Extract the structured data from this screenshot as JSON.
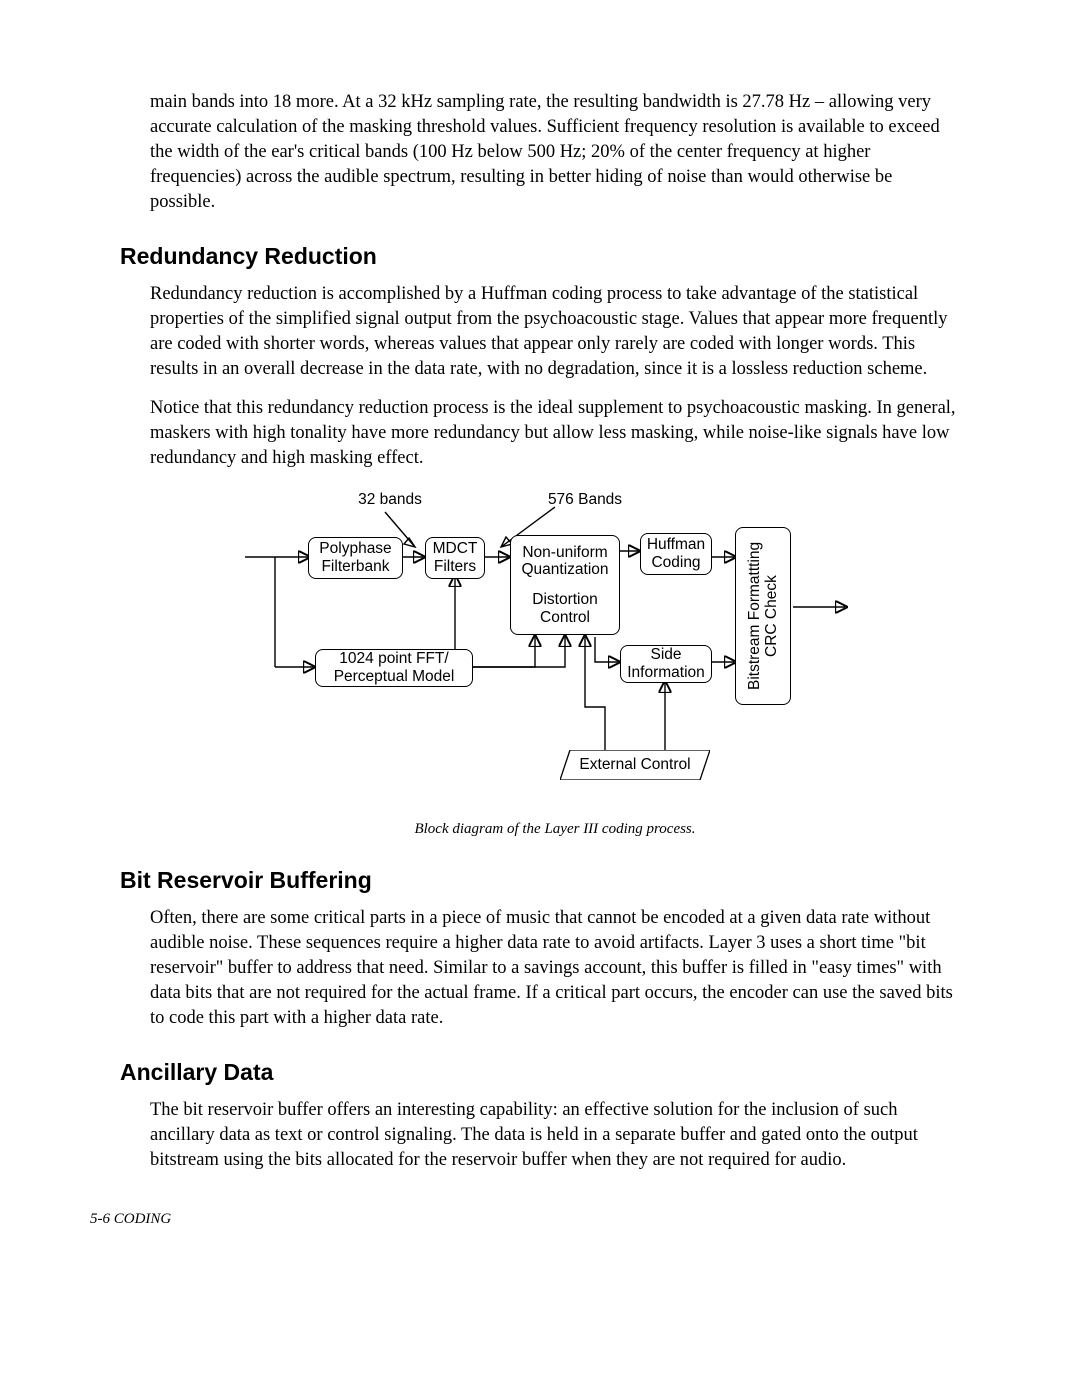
{
  "paragraphs": {
    "intro": "main bands into 18 more. At a 32 kHz sampling rate, the resulting bandwidth is 27.78 Hz – allowing very accurate calculation of the masking threshold values. Sufficient frequency resolution is available to exceed the width of the ear's critical bands (100 Hz below 500 Hz; 20% of the center frequency at higher frequencies) across the audible spectrum, resulting in better hiding of noise than would otherwise be possible.",
    "rr1": "Redundancy reduction is accomplished by a Huffman coding process to take advantage of the statistical properties of the simplified signal output from the psychoacoustic stage. Values that appear more frequently are coded with shorter words, whereas values that appear only rarely are coded with longer words. This results in an overall decrease in the data rate, with no degradation, since it is a lossless reduction scheme.",
    "rr2": "Notice that this redundancy reduction process is the ideal supplement to psychoacoustic masking. In general, maskers with high tonality have more redundancy but allow less masking, while noise-like signals have low redundancy and high masking effect.",
    "brb": "Often, there are some critical parts in a piece of music that cannot be encoded at a given data rate without audible noise. These sequences require a higher data rate to avoid artifacts. Layer 3 uses a short time \"bit reservoir\" buffer to address that need. Similar to a savings account, this buffer is filled in \"easy times\" with data bits that are not required for the actual frame. If a critical part occurs, the encoder can use the saved bits to code this part with a higher data rate.",
    "anc": "The bit reservoir buffer offers an interesting capability: an effective solution for the inclusion of such ancillary data as text or control signaling. The data is held in a separate buffer and gated onto the output bitstream using the bits allocated for the reservoir buffer when they are not required for audio."
  },
  "headings": {
    "rr": "Redundancy Reduction",
    "brb": "Bit Reservoir Buffering",
    "anc": "Ancillary Data"
  },
  "diagram": {
    "label_32": "32 bands",
    "label_576": "576 Bands",
    "polyphase": "Polyphase Filterbank",
    "mdct": "MDCT Filters",
    "quant_line1": "Non-uniform Quantization",
    "quant_line2": "Distortion Control",
    "huffman": "Huffman Coding",
    "bitstream": "Bitstream Formattting CRC Check",
    "fft": "1024 point FFT/ Perceptual Model",
    "side": "Side Information",
    "external": "External Control",
    "caption": "Block diagram of the Layer III coding process."
  },
  "footer": "5-6   CODING"
}
